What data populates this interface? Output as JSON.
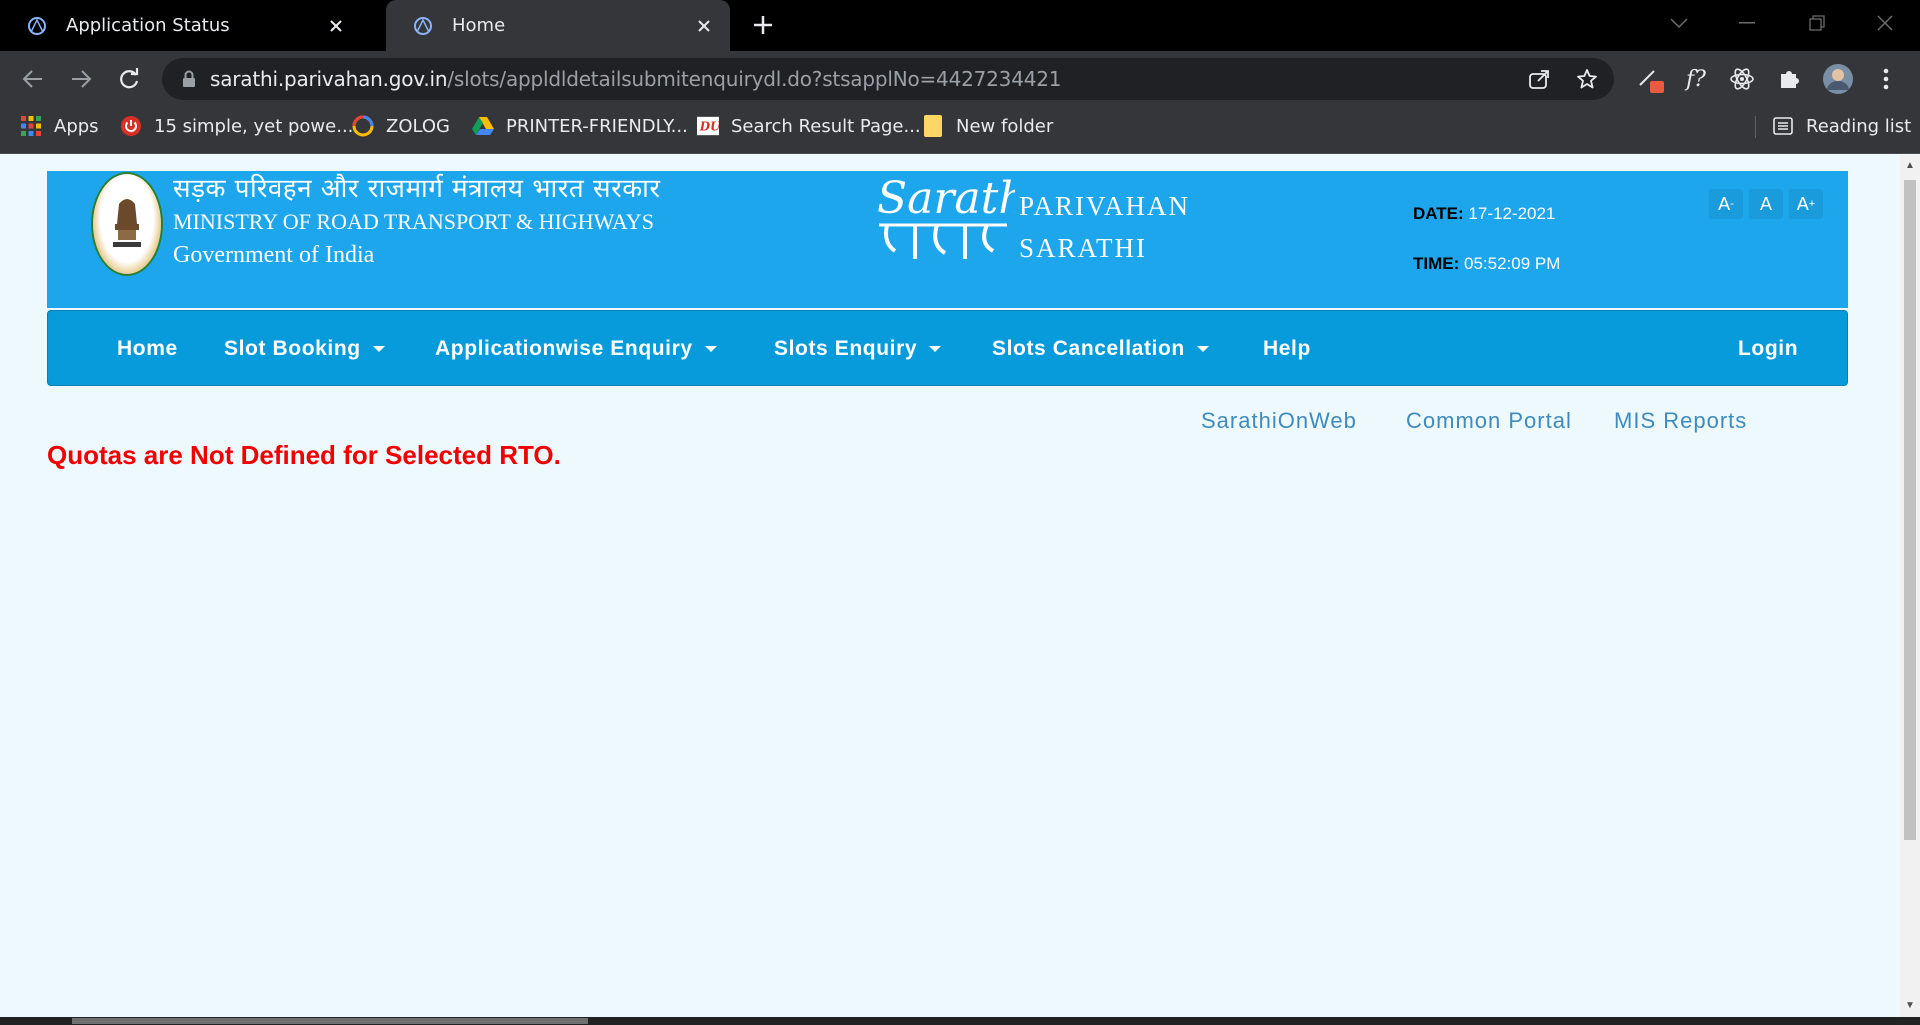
{
  "browser": {
    "tabs": [
      {
        "title": "Application Status",
        "active": false
      },
      {
        "title": "Home",
        "active": true
      }
    ],
    "url_host": "sarathi.parivahan.gov.in",
    "url_path": "/slots/appldldetailsubmitenquirydl.do?stsapplNo=4427234421",
    "bookmarks": [
      {
        "label": "Apps",
        "icon": "apps-grid-icon"
      },
      {
        "label": "15 simple, yet powe...",
        "icon": "power-icon"
      },
      {
        "label": "ZOLOG",
        "icon": "zolog-icon"
      },
      {
        "label": "PRINTER-FRIENDLY...",
        "icon": "drive-icon"
      },
      {
        "label": "Search Result Page...",
        "icon": "du-icon"
      },
      {
        "label": "New folder",
        "icon": "folder-icon"
      }
    ],
    "reading_list": "Reading list"
  },
  "header": {
    "hindi_title": "सड़क परिवहन और राजमार्ग मंत्रालय भारत सरकार",
    "ministry": "MINISTRY OF ROAD TRANSPORT & HIGHWAYS",
    "government": "Government of India",
    "logo_text": "Sarathi",
    "brand_line1": "PARIVAHAN",
    "brand_line2": "SARATHI",
    "date_label": "DATE:",
    "date_value": "17-12-2021",
    "time_label": "TIME:",
    "time_value": "05:52:09 PM",
    "font_controls": [
      "A-",
      "A",
      "A+"
    ]
  },
  "nav": {
    "items": [
      {
        "label": "Home",
        "dropdown": false
      },
      {
        "label": "Slot Booking",
        "dropdown": true
      },
      {
        "label": "Applicationwise Enquiry",
        "dropdown": true
      },
      {
        "label": "Slots Enquiry",
        "dropdown": true
      },
      {
        "label": "Slots Cancellation",
        "dropdown": true
      },
      {
        "label": "Help",
        "dropdown": false
      }
    ],
    "login": "Login"
  },
  "quick_links": [
    "SarathiOnWeb",
    "Common Portal",
    "MIS Reports"
  ],
  "message": "Quotas are Not Defined for Selected RTO.",
  "colors": {
    "header_bg": "#1da6ec",
    "nav_bg": "#079bdb",
    "page_bg": "#edf9fd",
    "error": "#f20000",
    "link": "#3f8bbf"
  }
}
